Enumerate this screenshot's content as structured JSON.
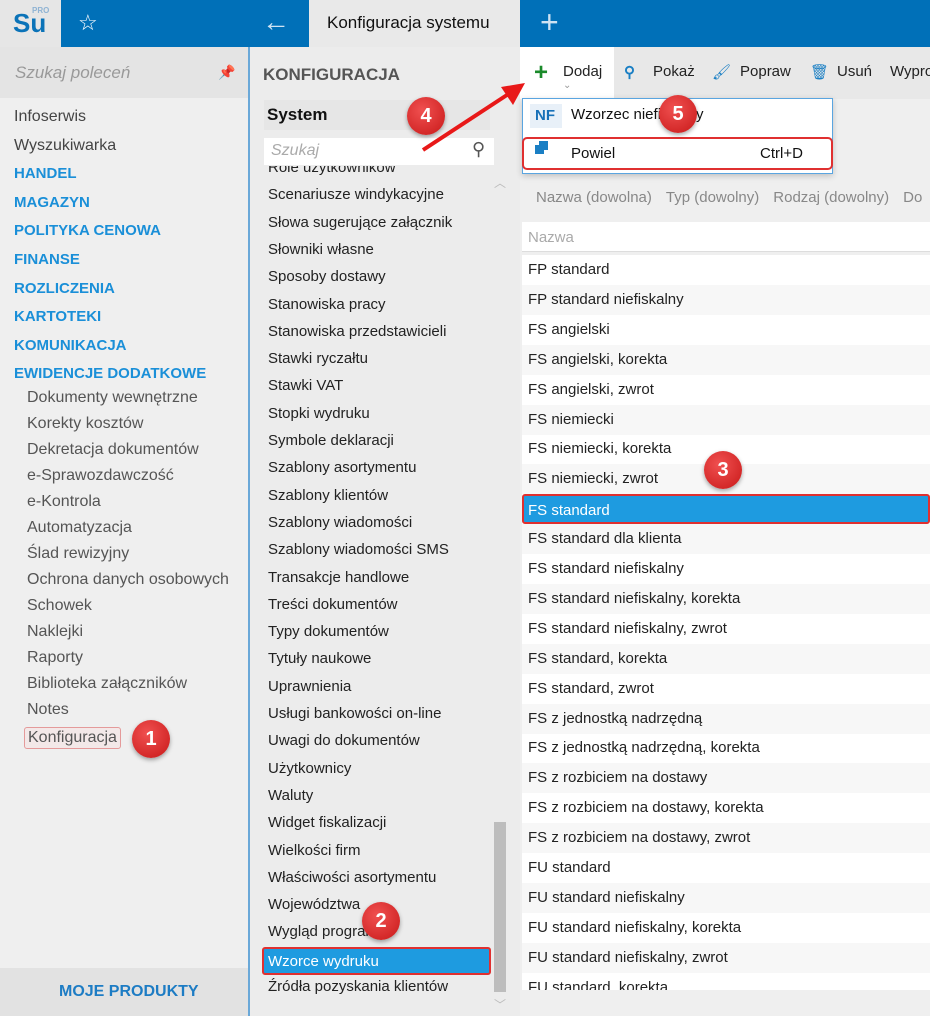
{
  "header": {
    "logo": "Su",
    "logo_sup": "PRO",
    "tab_title": "Konfiguracja systemu"
  },
  "sidebar": {
    "search_placeholder": "Szukaj poleceń",
    "items": [
      {
        "label": "Infoserwis",
        "type": "item"
      },
      {
        "label": "Wyszukiwarka",
        "type": "item"
      },
      {
        "label": "HANDEL",
        "type": "h"
      },
      {
        "label": "MAGAZYN",
        "type": "h"
      },
      {
        "label": "POLITYKA CENOWA",
        "type": "h"
      },
      {
        "label": "FINANSE",
        "type": "h"
      },
      {
        "label": "ROZLICZENIA",
        "type": "h"
      },
      {
        "label": "KARTOTEKI",
        "type": "h"
      },
      {
        "label": "KOMUNIKACJA",
        "type": "h"
      },
      {
        "label": "EWIDENCJE DODATKOWE",
        "type": "h"
      }
    ],
    "subitems": [
      "Dokumenty wewnętrzne",
      "Korekty kosztów",
      "Dekretacja dokumentów",
      "e-Sprawozdawczość",
      "e-Kontrola",
      "Automatyzacja",
      "Ślad rewizyjny",
      "Ochrona danych osobowych",
      "Schowek",
      "Naklejki",
      "Raporty",
      "Biblioteka załączników",
      "Notes",
      "Konfiguracja"
    ],
    "footer": "MOJE PRODUKTY"
  },
  "config": {
    "title": "KONFIGURACJA",
    "select": "System",
    "search_placeholder": "Szukaj",
    "items": [
      "Role użytkowników",
      "Scenariusze windykacyjne",
      "Słowa sugerujące załącznik",
      "Słowniki własne",
      "Sposoby dostawy",
      "Stanowiska pracy",
      "Stanowiska przedstawicieli",
      "Stawki ryczałtu",
      "Stawki VAT",
      "Stopki wydruku",
      "Symbole deklaracji",
      "Szablony asortymentu",
      "Szablony klientów",
      "Szablony wiadomości",
      "Szablony wiadomości SMS",
      "Transakcje handlowe",
      "Treści dokumentów",
      "Typy dokumentów",
      "Tytuły naukowe",
      "Uprawnienia",
      "Usługi bankowości on-line",
      "Uwagi do dokumentów",
      "Użytkownicy",
      "Waluty",
      "Widget fiskalizacji",
      "Wielkości firm",
      "Właściwości asortymentu",
      "Województwa",
      "Wygląd programu",
      "Wzorce wydruku",
      "Źródła pozyskania klientów"
    ],
    "selected": "Wzorce wydruku"
  },
  "toolbar": {
    "add": "Dodaj",
    "show": "Pokaż",
    "edit": "Popraw",
    "delete": "Usuń",
    "export": "Wypro"
  },
  "add_menu": {
    "nf_badge": "NF",
    "item1": "Wzorzec niefiskalny",
    "item2": "Powiel",
    "item2_shortcut": "Ctrl+D"
  },
  "filters": [
    "Nazwa (dowolna)",
    "Typ (dowolny)",
    "Rodzaj (dowolny)",
    "Do"
  ],
  "grid": {
    "column": "Nazwa",
    "selected": "FS standard",
    "rows": [
      "FP standard",
      "FP standard niefiskalny",
      "FS angielski",
      "FS angielski, korekta",
      "FS angielski, zwrot",
      "FS niemiecki",
      "FS niemiecki, korekta",
      "FS niemiecki, zwrot",
      "FS standard",
      "FS standard dla klienta",
      "FS standard niefiskalny",
      "FS standard niefiskalny, korekta",
      "FS standard niefiskalny, zwrot",
      "FS standard, korekta",
      "FS standard, zwrot",
      "FS z jednostką nadrzędną",
      "FS z jednostką nadrzędną, korekta",
      "FS z rozbiciem na dostawy",
      "FS z rozbiciem na dostawy, korekta",
      "FS z rozbiciem na dostawy, zwrot",
      "FU standard",
      "FU standard niefiskalny",
      "FU standard niefiskalny, korekta",
      "FU standard niefiskalny, zwrot",
      "FU standard, korekta"
    ]
  },
  "annotations": [
    "1",
    "2",
    "3",
    "4",
    "5"
  ]
}
